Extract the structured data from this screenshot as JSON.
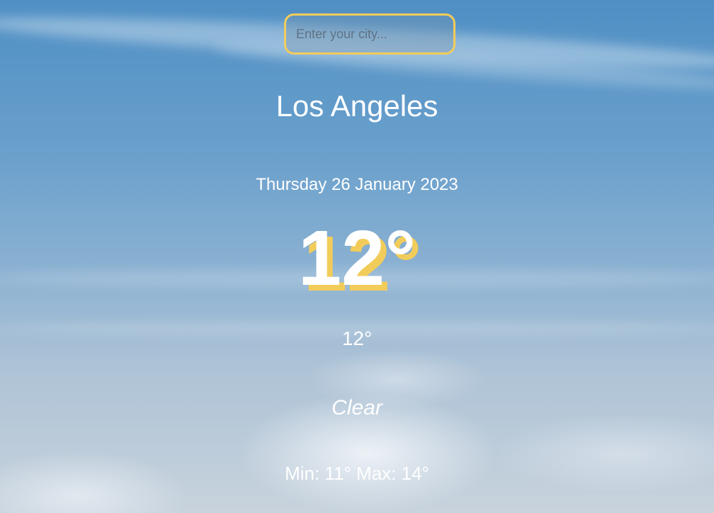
{
  "search": {
    "placeholder": "Enter your city...",
    "value": ""
  },
  "location": {
    "city": "Los Angeles",
    "date": "Thursday 26 January 2023"
  },
  "weather": {
    "temperature": "12°",
    "feels_like": "12°",
    "condition": "Clear",
    "min_max": "Min: 11° Max: 14°"
  },
  "colors": {
    "accent": "#f2cc5a",
    "text": "#ffffff",
    "sky_top": "#4f8fc4",
    "sky_bottom": "#c8d3dd"
  }
}
